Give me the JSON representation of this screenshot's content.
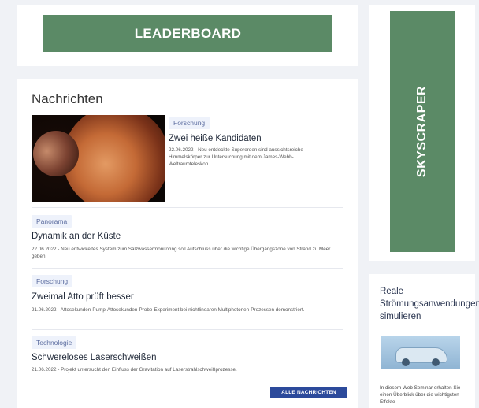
{
  "ads": {
    "leaderboard": "LEADERBOARD",
    "skyscraper": "SKYSCRAPER"
  },
  "news": {
    "title": "Nachrichten",
    "featured": {
      "tag": "Forschung",
      "headline": "Zwei heiße Kandidaten",
      "teaser": "22.06.2022 - Neu entdeckte Supererden sind aussichtsreiche Himmelskörper zur Untersuchung mit dem James-Webb-Weltraumteleskop."
    },
    "items": [
      {
        "tag": "Panorama",
        "headline": "Dynamik an der Küste",
        "teaser": "22.06.2022 - Neu entwickeltes System zum Salzwassermonitoring soll Aufschluss über die wichtige Übergangszone von Strand zu Meer geben."
      },
      {
        "tag": "Forschung",
        "headline": "Zweimal Atto prüft besser",
        "teaser": "21.06.2022 - Attosekunden-Pump-Attosekunden-Probe-Experiment bei nichtlinearen Multiphotonen-Prozessen demonstriert."
      },
      {
        "tag": "Technologie",
        "headline": "Schwereloses Laserschweißen",
        "teaser": "21.06.2022 - Projekt untersucht den Einfluss der Gravitation auf Laserstrahlschweißprozesse."
      }
    ],
    "all_button": "ALLE NACHRICHTEN"
  },
  "promo": {
    "title": "Reale Strömungsanwendungen simulieren",
    "text": "In diesem Web Seminar erhalten Sie einen Überblick über die wichtigsten Effekte"
  },
  "colors": {
    "ad_green": "#5b8a66",
    "button_blue": "#2c4a9b",
    "tag_bg": "#eef2fb"
  }
}
